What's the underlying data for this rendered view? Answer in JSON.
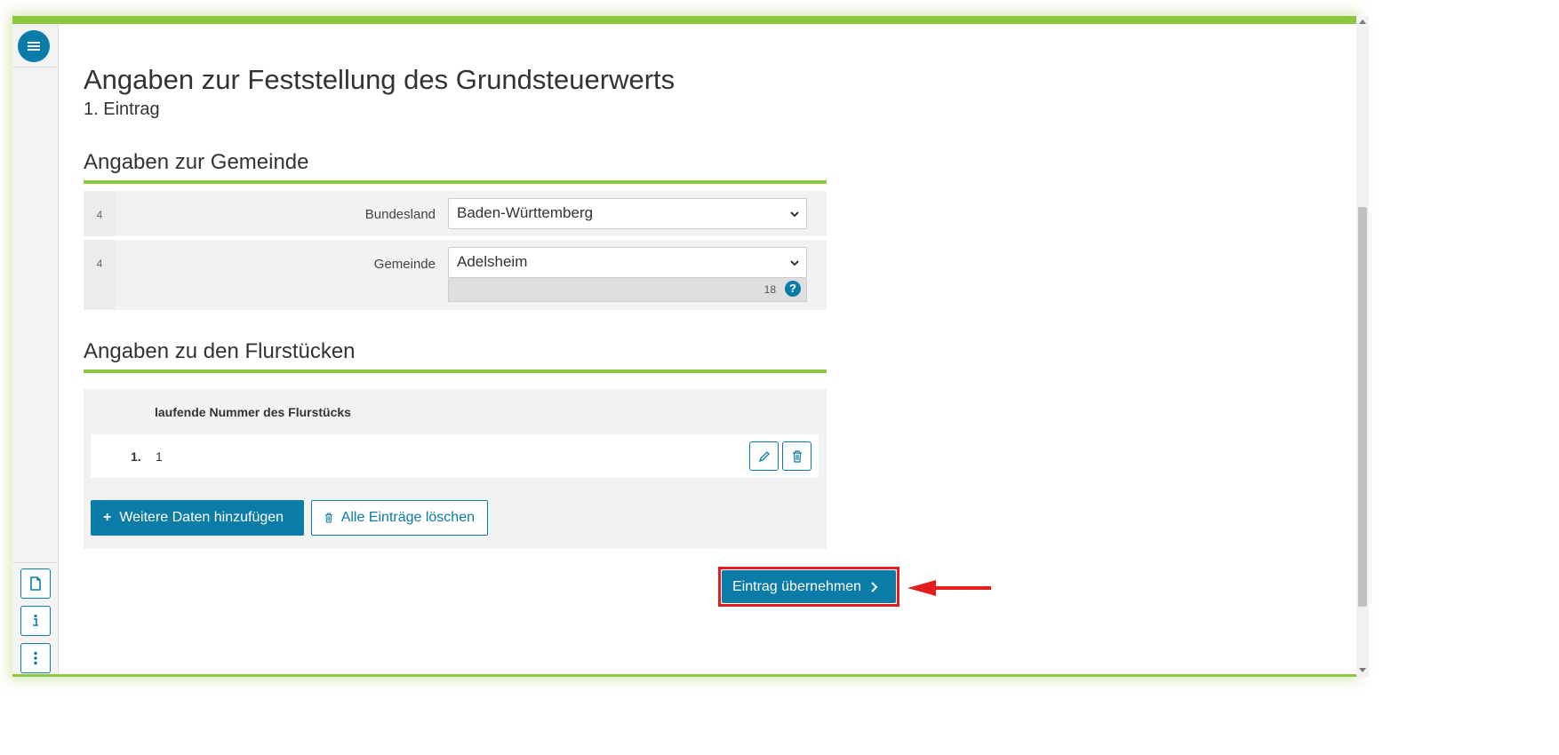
{
  "page": {
    "title": "Angaben zur Feststellung des Grundsteuerwerts",
    "subtitle": "1. Eintrag"
  },
  "gemeinde_section": {
    "heading": "Angaben zur Gemeinde",
    "rows": [
      {
        "number": "4",
        "label": "Bundesland",
        "value": "Baden-Württemberg"
      },
      {
        "number": "4",
        "label": "Gemeinde",
        "value": "Adelsheim",
        "counter": "18",
        "help": "?"
      }
    ]
  },
  "flurstuecke_section": {
    "heading": "Angaben zu den Flurstücken",
    "column_header": "laufende Nummer des Flurstücks",
    "entries": [
      {
        "index": "1.",
        "value": "1"
      }
    ],
    "add_button_label": "Weitere Daten hinzufügen",
    "add_button_symbol": "+",
    "delete_all_label": "Alle Einträge löschen"
  },
  "submit": {
    "label": "Eintrag übernehmen"
  },
  "colors": {
    "accent_green": "#8dc63f",
    "primary_blue": "#0b7ba8",
    "highlight_red": "#e41e1e"
  },
  "icons": {
    "menu": "menu-icon",
    "document": "document-icon",
    "info": "info-icon",
    "more": "more-vertical-icon",
    "edit": "pencil-icon",
    "delete": "trash-icon",
    "dropdown": "chevron-down-icon",
    "next": "chevron-right-icon",
    "annotation": "red-arrow-icon"
  }
}
